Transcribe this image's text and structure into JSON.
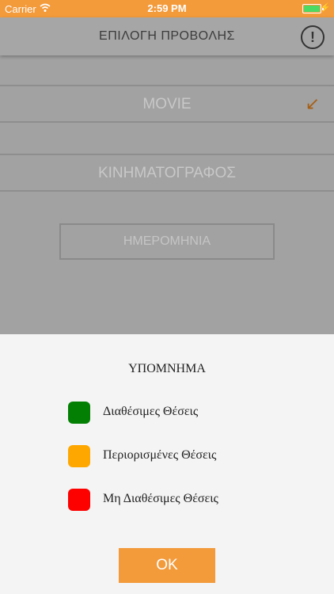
{
  "status_bar": {
    "carrier": "Carrier",
    "time": "2:59 PM"
  },
  "nav": {
    "title": "ΕΠΙΛΟΓΗ ΠΡΟΒΟΛΗΣ",
    "info_icon": "exclamation-circle-icon"
  },
  "form": {
    "movie_label": "MOVIE",
    "cinema_label": "ΚΙΝΗΜΑΤΟΓΡΑΦΟΣ",
    "date_label": "ΗΜΕΡΟΜΗΝΙΑ",
    "movie_arrow_icon": "arrow-down-left-icon"
  },
  "legend": {
    "title": "ΥΠΟΜΝΗΜΑ",
    "items": [
      {
        "label": "Διαθέσιμες Θέσεις",
        "color": "#038003"
      },
      {
        "label": "Περιορισμένες Θέσεις",
        "color": "#fda700"
      },
      {
        "label": "Μη Διαθέσιμες Θέσεις",
        "color": "#fd0000"
      }
    ],
    "ok_label": "OK"
  },
  "colors": {
    "accent": "#f39a3b"
  }
}
